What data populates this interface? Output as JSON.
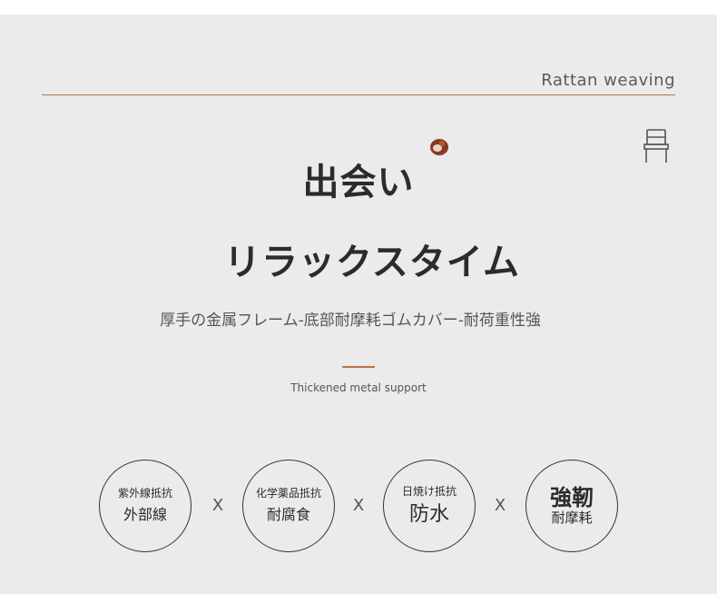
{
  "brand": "Rattan weaving",
  "title_line1": "出会い",
  "title_line2": "リラックスタイム",
  "subtitle": "厚手の金属フレーム-底部耐摩耗ゴムカバー-耐荷重性強",
  "caption": "Thickened metal support",
  "icons": {
    "chair": "chair-icon",
    "decor": "acorn-decor-icon"
  },
  "colors": {
    "background": "#ebebeb",
    "accent": "#b8734f",
    "text": "#2b2b2b"
  },
  "separator": "X",
  "badges": [
    {
      "top": "紫外線抵抗",
      "main": "外部線"
    },
    {
      "top": "化学薬品抵抗",
      "main": "耐腐食"
    },
    {
      "top": "日焼け抵抗",
      "main": "防水"
    },
    {
      "top": "強靭",
      "main": "耐摩耗"
    }
  ]
}
